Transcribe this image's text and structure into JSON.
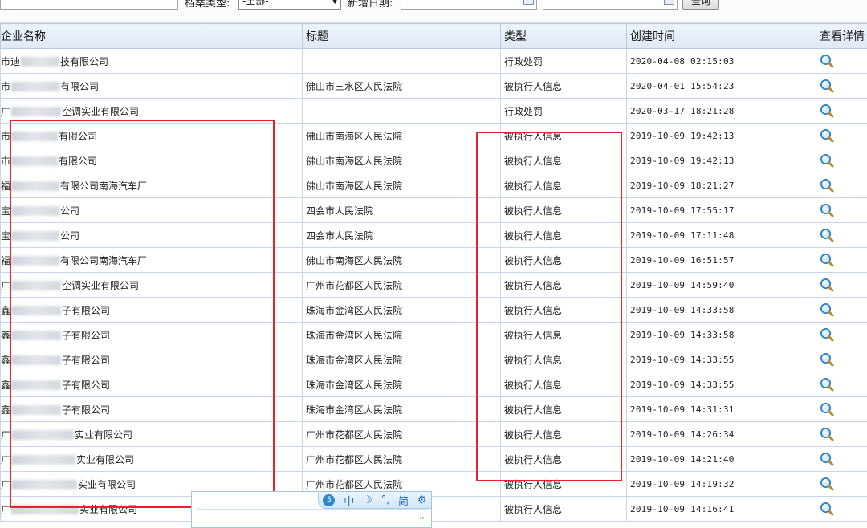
{
  "filter": {
    "type_label": "档案类型:",
    "type_value": "-全部-",
    "date_label": "新增日期:",
    "date_separator": "-",
    "query_button": "查询"
  },
  "table": {
    "columns": [
      "企业名称",
      "标题",
      "类型",
      "创建时间",
      "查看详情"
    ],
    "rows": [
      {
        "name_prefix": "市迪",
        "name_suffix": "技有限公司",
        "title": "",
        "type": "行政处罚",
        "time": "2020-04-08 02:15:03"
      },
      {
        "name_prefix": "市",
        "name_suffix": "有限公司",
        "title": "佛山市三水区人民法院",
        "type": "被执行人信息",
        "time": "2020-04-01 15:54:23"
      },
      {
        "name_prefix": "广",
        "name_suffix": "空调实业有限公司",
        "title": "",
        "type": "行政处罚",
        "time": "2020-03-17 18:21:28"
      },
      {
        "name_prefix": "市",
        "name_suffix": "有限公司",
        "title": "佛山市南海区人民法院",
        "type": "被执行人信息",
        "time": "2019-10-09 19:42:13"
      },
      {
        "name_prefix": "市",
        "name_suffix": "有限公司",
        "title": "佛山市南海区人民法院",
        "type": "被执行人信息",
        "time": "2019-10-09 19:42:13"
      },
      {
        "name_prefix": "福",
        "name_suffix": "有限公司南海汽车厂",
        "title": "佛山市南海区人民法院",
        "type": "被执行人信息",
        "time": "2019-10-09 18:21:27"
      },
      {
        "name_prefix": "宝",
        "name_suffix": "公司",
        "title": "四会市人民法院",
        "type": "被执行人信息",
        "time": "2019-10-09 17:55:17"
      },
      {
        "name_prefix": "宝",
        "name_suffix": "公司",
        "title": "四会市人民法院",
        "type": "被执行人信息",
        "time": "2019-10-09 17:11:48"
      },
      {
        "name_prefix": "福",
        "name_suffix": "有限公司南海汽车厂",
        "title": "佛山市南海区人民法院",
        "type": "被执行人信息",
        "time": "2019-10-09 16:51:57"
      },
      {
        "name_prefix": "广",
        "name_suffix": "空调实业有限公司",
        "title": "广州市花都区人民法院",
        "type": "被执行人信息",
        "time": "2019-10-09 14:59:40"
      },
      {
        "name_prefix": "鑫",
        "name_suffix": "子有限公司",
        "title": "珠海市金湾区人民法院",
        "type": "被执行人信息",
        "time": "2019-10-09 14:33:58"
      },
      {
        "name_prefix": "鑫",
        "name_suffix": "子有限公司",
        "title": "珠海市金湾区人民法院",
        "type": "被执行人信息",
        "time": "2019-10-09 14:33:58"
      },
      {
        "name_prefix": "鑫",
        "name_suffix": "子有限公司",
        "title": "珠海市金湾区人民法院",
        "type": "被执行人信息",
        "time": "2019-10-09 14:33:55"
      },
      {
        "name_prefix": "鑫",
        "name_suffix": "子有限公司",
        "title": "珠海市金湾区人民法院",
        "type": "被执行人信息",
        "time": "2019-10-09 14:33:55"
      },
      {
        "name_prefix": "鑫",
        "name_suffix": "子有限公司",
        "title": "珠海市金湾区人民法院",
        "type": "被执行人信息",
        "time": "2019-10-09 14:31:31"
      },
      {
        "name_prefix": "广",
        "name_suffix": "实业有限公司",
        "title": "广州市花都区人民法院",
        "type": "被执行人信息",
        "time": "2019-10-09 14:26:34"
      },
      {
        "name_prefix": "广",
        "name_suffix": "实业有限公司",
        "title": "广州市花都区人民法院",
        "type": "被执行人信息",
        "time": "2019-10-09 14:21:40"
      },
      {
        "name_prefix": "广",
        "name_suffix": "实业有限公司",
        "title": "广州市花都区人民法院",
        "type": "被执行人信息",
        "time": "2019-10-09 14:19:32"
      },
      {
        "name_prefix": "广",
        "name_suffix": "实业有限公司",
        "title": "",
        "type": "被执行人信息",
        "time": "2019-10-09 14:16:41"
      }
    ]
  },
  "ime": {
    "logo": "S",
    "lang": "中",
    "moon": "☽",
    "punct": "°,",
    "simplified": "简",
    "gear": "⚙",
    "arrows": "‹›"
  },
  "colors": {
    "annotation_red": "#e1252a",
    "header_bg": "#e4ecf6",
    "grid_line": "#c7d6ea"
  }
}
